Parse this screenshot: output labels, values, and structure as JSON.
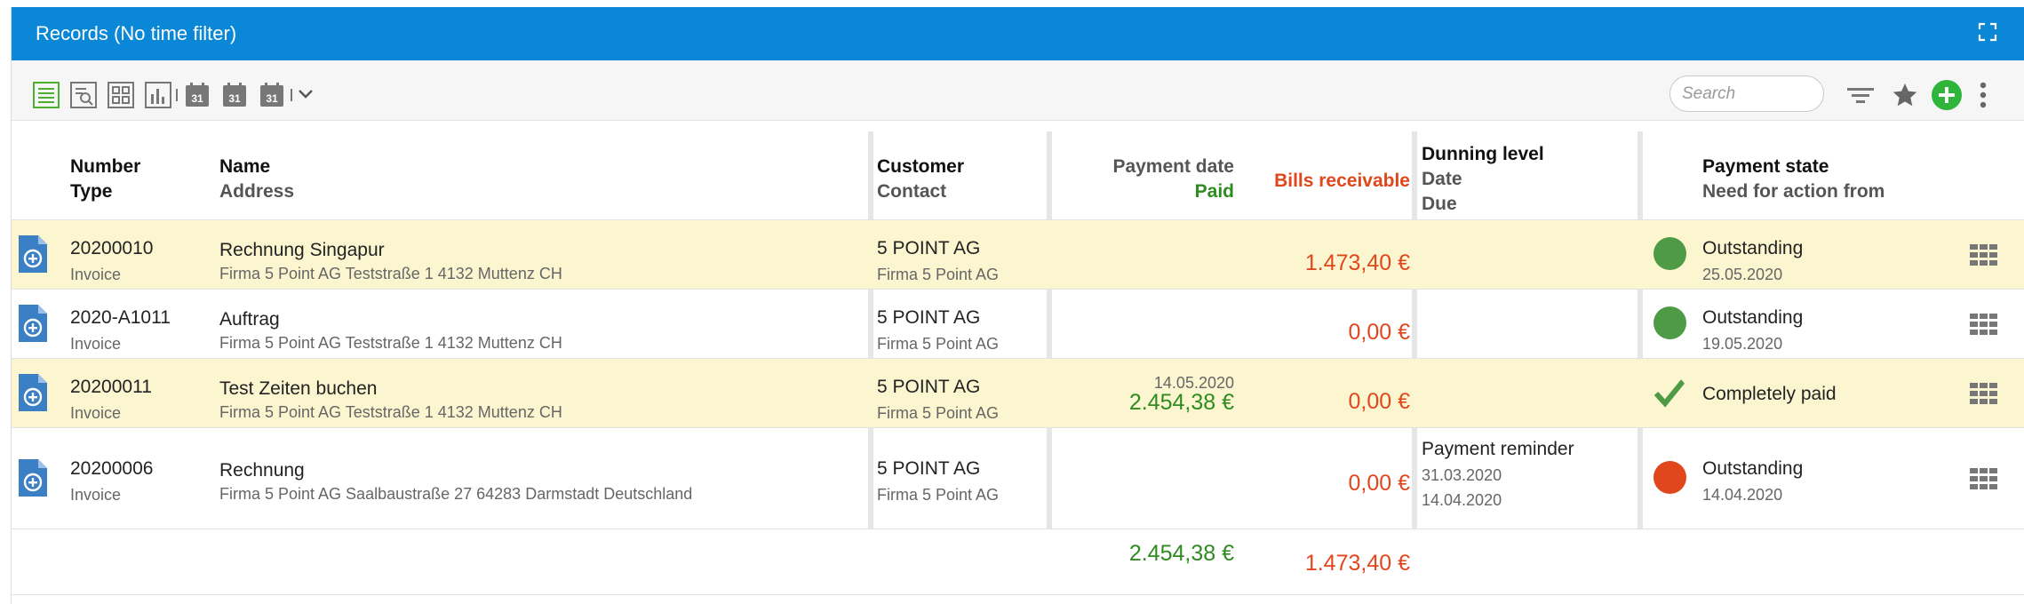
{
  "window": {
    "title": "Records (No time filter)"
  },
  "toolbar": {
    "search_placeholder": "Search"
  },
  "columns": {
    "number": "Number",
    "type": "Type",
    "name": "Name",
    "address": "Address",
    "customer": "Customer",
    "contact": "Contact",
    "payment_date": "Payment date",
    "paid": "Paid",
    "bills_receivable": "Bills receivable",
    "dunning_level": "Dunning level",
    "date": "Date",
    "due": "Due",
    "payment_state": "Payment state",
    "need_for_action": "Need for action from"
  },
  "rows": [
    {
      "number": "20200010",
      "type": "Invoice",
      "name": "Rechnung Singapur",
      "address": "Firma 5 Point AG Teststraße 1 4132 Muttenz CH",
      "customer": "5 POINT AG",
      "contact": "Firma 5 Point AG",
      "payment_date": "",
      "paid": "",
      "bills_receivable": "1.473,40 €",
      "dunning_level": "",
      "dunning_date": "",
      "dunning_due": "",
      "state": "Outstanding",
      "state_date": "25.05.2020",
      "state_kind": "green-dot"
    },
    {
      "number": "2020-A1011",
      "type": "Invoice",
      "name": "Auftrag",
      "address": "Firma 5 Point AG Teststraße 1 4132 Muttenz CH",
      "customer": "5 POINT AG",
      "contact": "Firma 5 Point AG",
      "payment_date": "",
      "paid": "",
      "bills_receivable": "0,00 €",
      "dunning_level": "",
      "dunning_date": "",
      "dunning_due": "",
      "state": "Outstanding",
      "state_date": "19.05.2020",
      "state_kind": "green-dot"
    },
    {
      "number": "20200011",
      "type": "Invoice",
      "name": "Test Zeiten buchen",
      "address": "Firma 5 Point AG Teststraße 1 4132 Muttenz CH",
      "customer": "5 POINT AG",
      "contact": "Firma 5 Point AG",
      "payment_date": "14.05.2020",
      "paid": "2.454,38 €",
      "bills_receivable": "0,00 €",
      "dunning_level": "",
      "dunning_date": "",
      "dunning_due": "",
      "state": "Completely paid",
      "state_date": "",
      "state_kind": "check"
    },
    {
      "number": "20200006",
      "type": "Invoice",
      "name": "Rechnung",
      "address": "Firma 5 Point AG Saalbaustraße 27 64283 Darmstadt Deutschland",
      "customer": "5 POINT AG",
      "contact": "Firma 5 Point AG",
      "payment_date": "",
      "paid": "",
      "bills_receivable": "0,00 €",
      "dunning_level": "Payment reminder",
      "dunning_date": "31.03.2020",
      "dunning_due": "14.04.2020",
      "state": "Outstanding",
      "state_date": "14.04.2020",
      "state_kind": "red-dot"
    }
  ],
  "totals": {
    "paid": "2.454,38 €",
    "bills_receivable": "1.473,40 €"
  },
  "colors": {
    "header_bar": "#0a87d6",
    "highlight_row": "#fcf6d0",
    "paid_green": "#2e8b1f",
    "receivable_red": "#e0471c",
    "status_green": "#4e9a45",
    "status_red": "#e0471c"
  },
  "icons": {
    "toolbar": [
      "list-view-icon",
      "search-document-icon",
      "grid-view-icon",
      "chart-icon",
      "calendar-icon",
      "calendar-icon",
      "calendar-icon",
      "chevron-down-icon",
      "filter-icon",
      "star-icon",
      "add-icon",
      "more-vert-icon"
    ],
    "window": "expand-icon",
    "row": [
      "document-add-icon",
      "status-dot",
      "grid-menu-icon"
    ]
  }
}
